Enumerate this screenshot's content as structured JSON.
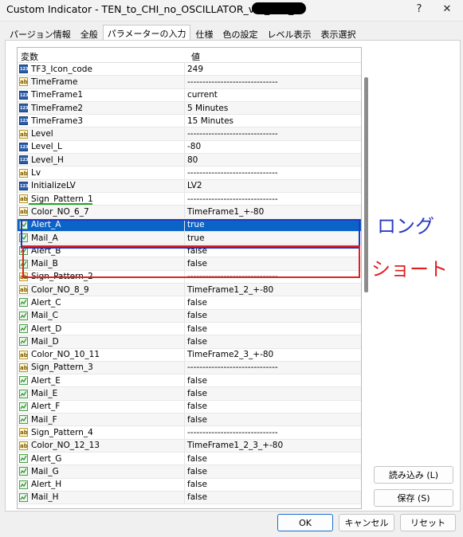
{
  "window": {
    "title": "Custom Indicator - TEN_to_CHI_no_OSCILLATOR_ver_005_",
    "help_glyph": "?",
    "close_glyph": "✕"
  },
  "tabs": [
    "パージョン情報",
    "全般",
    "パラメーターの入力",
    "仕様",
    "色の設定",
    "レベル表示",
    "表示選択"
  ],
  "table": {
    "headers": {
      "name": "変数",
      "value": "値"
    },
    "rows": [
      {
        "icon": "int",
        "name": "TF3_Icon_code",
        "value": "249"
      },
      {
        "icon": "str",
        "name": "TimeFrame",
        "value": "------------------------------"
      },
      {
        "icon": "int",
        "name": "TimeFrame1",
        "value": "current"
      },
      {
        "icon": "int",
        "name": "TimeFrame2",
        "value": "5 Minutes"
      },
      {
        "icon": "int",
        "name": "TimeFrame3",
        "value": "15 Minutes"
      },
      {
        "icon": "str",
        "name": "Level",
        "value": "------------------------------"
      },
      {
        "icon": "int",
        "name": "Level_L",
        "value": "-80"
      },
      {
        "icon": "int",
        "name": "Level_H",
        "value": "80"
      },
      {
        "icon": "str",
        "name": "Lv",
        "value": "------------------------------"
      },
      {
        "icon": "int",
        "name": "InitializeLV",
        "value": "LV2"
      },
      {
        "icon": "str",
        "name": "Sign_Pattern_1",
        "value": "------------------------------"
      },
      {
        "icon": "str",
        "name": "Color_NO_6_7",
        "value": "TimeFrame1_+-80"
      },
      {
        "icon": "bool",
        "name": "Alert_A",
        "value": "true",
        "selected": true
      },
      {
        "icon": "bool",
        "name": "Mail_A",
        "value": "true"
      },
      {
        "icon": "bool",
        "name": "Alert_B",
        "value": "false"
      },
      {
        "icon": "bool",
        "name": "Mail_B",
        "value": "false"
      },
      {
        "icon": "str",
        "name": "Sign_Pattern_2",
        "value": "------------------------------"
      },
      {
        "icon": "str",
        "name": "Color_NO_8_9",
        "value": "TimeFrame1_2_+-80"
      },
      {
        "icon": "bool",
        "name": "Alert_C",
        "value": "false"
      },
      {
        "icon": "bool",
        "name": "Mail_C",
        "value": "false"
      },
      {
        "icon": "bool",
        "name": "Alert_D",
        "value": "false"
      },
      {
        "icon": "bool",
        "name": "Mail_D",
        "value": "false"
      },
      {
        "icon": "str",
        "name": "Color_NO_10_11",
        "value": "TimeFrame2_3_+-80"
      },
      {
        "icon": "str",
        "name": "Sign_Pattern_3",
        "value": "------------------------------"
      },
      {
        "icon": "bool",
        "name": "Alert_E",
        "value": "false"
      },
      {
        "icon": "bool",
        "name": "Mail_E",
        "value": "false"
      },
      {
        "icon": "bool",
        "name": "Alert_F",
        "value": "false"
      },
      {
        "icon": "bool",
        "name": "Mail_F",
        "value": "false"
      },
      {
        "icon": "str",
        "name": "Sign_Pattern_4",
        "value": "------------------------------"
      },
      {
        "icon": "str",
        "name": "Color_NO_12_13",
        "value": "TimeFrame1_2_3_+-80"
      },
      {
        "icon": "bool",
        "name": "Alert_G",
        "value": "false"
      },
      {
        "icon": "bool",
        "name": "Mail_G",
        "value": "false"
      },
      {
        "icon": "bool",
        "name": "Alert_H",
        "value": "false"
      },
      {
        "icon": "bool",
        "name": "Mail_H",
        "value": "false"
      }
    ]
  },
  "annotations": {
    "long": "ロング",
    "short": "ショート",
    "long_color": "#2b3bc4",
    "short_color": "#e02020"
  },
  "side_buttons": {
    "load": "読み込み (L)",
    "save": "保存 (S)"
  },
  "bottom_buttons": {
    "ok": "OK",
    "cancel": "キャンセル",
    "reset": "リセット"
  },
  "selection_color": "#0a64c8"
}
